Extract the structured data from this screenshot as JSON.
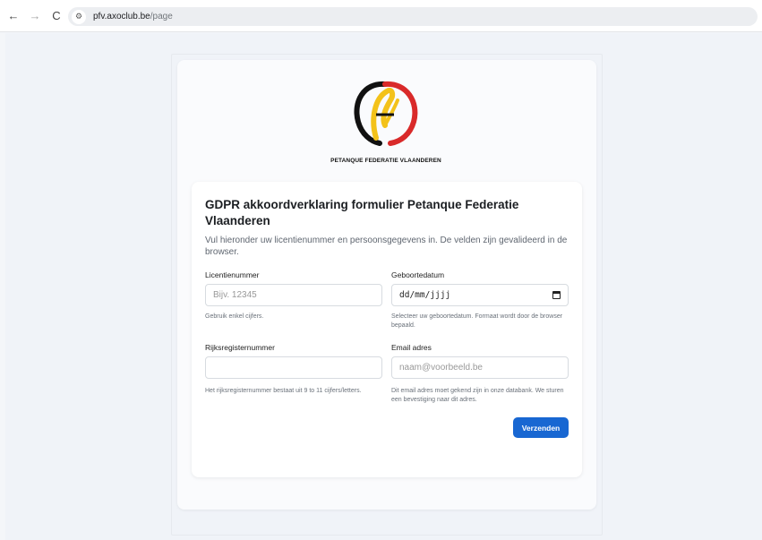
{
  "browser": {
    "back_icon": "←",
    "forward_icon": "→",
    "reload_icon": "C",
    "site_settings_icon": "⚙",
    "url_host": "pfv.axoclub.be",
    "url_path": "/page"
  },
  "logo": {
    "caption": "PETANQUE FEDERATIE VLAANDEREN",
    "colors": {
      "black": "#111111",
      "yellow": "#f3c21a",
      "red": "#d92a2a"
    }
  },
  "form": {
    "title": "GDPR akkoordverklaring formulier Petanque Federatie Vlaanderen",
    "intro": "Vul hieronder uw licentienummer en persoonsgegevens in. De velden zijn gevalideerd in de browser.",
    "license": {
      "label": "Licentienummer",
      "placeholder": "Bijv. 12345",
      "help": "Gebruik enkel cijfers."
    },
    "birthdate": {
      "label": "Geboortedatum",
      "placeholder": "dd/mm/jjjj",
      "help": "Selecteer uw geboortedatum. Formaat wordt door de browser bepaald."
    },
    "national_number": {
      "label": "Rijksregisternummer",
      "placeholder": "",
      "help": "Het rijksregisternummer bestaat uit 9 to 11 cijfers/letters."
    },
    "email": {
      "label": "Email adres",
      "placeholder": "naam@voorbeeld.be",
      "help": "Dit email adres moet gekend zijn in onze databank. We sturen een bevestiging naar dit adres."
    },
    "submit_label": "Verzenden",
    "accent_color": "#1867d2"
  }
}
